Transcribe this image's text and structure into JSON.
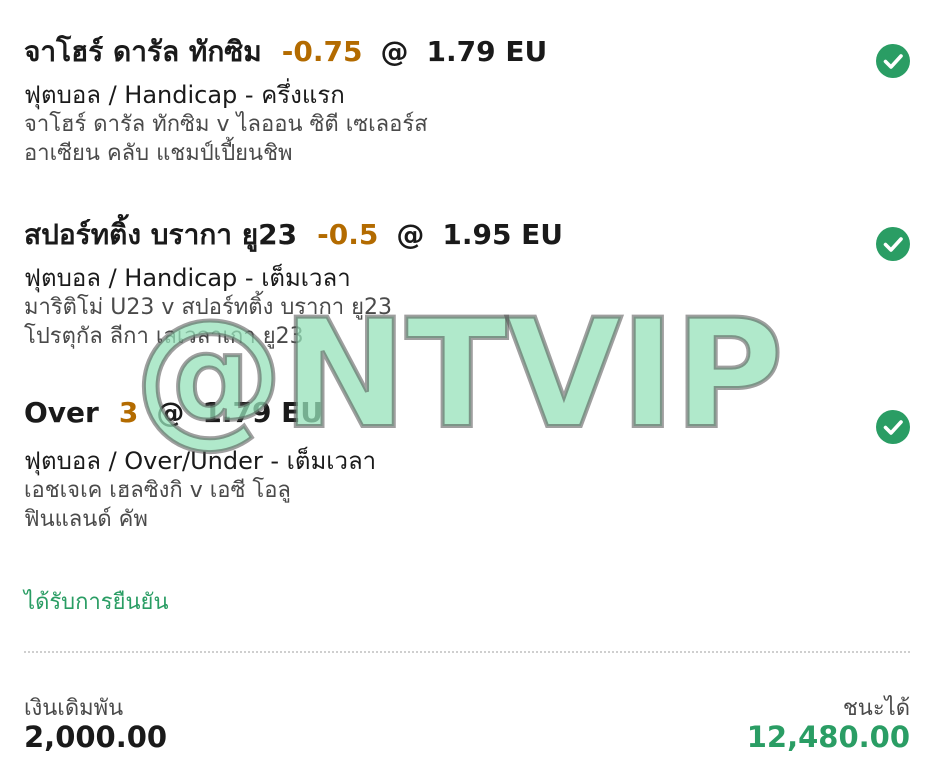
{
  "bets": [
    {
      "selection": "จาโฮร์ ดารัล ทักซิม",
      "handicap": "-0.75",
      "at": "@",
      "odds": "1.79 EU",
      "market": "ฟุตบอล / Handicap - ครึ่งแรก",
      "match": "จาโฮร์ ดารัล ทักซิม v ไลออน ซิตี เซเลอร์ส",
      "league": "อาเซียน คลับ แชมป์เปี้ยนชิพ",
      "status_icon": "check-circle-icon"
    },
    {
      "selection": "สปอร์ทติ้ง บรากา ยู23",
      "handicap": "-0.5",
      "at": "@",
      "odds": "1.95 EU",
      "market": "ฟุตบอล / Handicap - เต็มเวลา",
      "match": "มาริติโม่ U23 v สปอร์ทติ้ง บรากา ยู23",
      "league": "โปรตุกัล ลีกา เลเวลาเกา ยู23",
      "status_icon": "check-circle-icon"
    },
    {
      "selection": "Over",
      "handicap": "3",
      "at": "@",
      "odds": "1.79 EU",
      "market": "ฟุตบอล / Over/Under - เต็มเวลา",
      "match": "เอชเจเค เฮลซิงกิ v เอซี โอลู",
      "league": "ฟินแลนด์ คัพ",
      "status_icon": "check-circle-icon"
    }
  ],
  "status_text": "ได้รับการยืนยัน",
  "stake": {
    "label": "เงินเดิมพัน",
    "value": "2,000.00"
  },
  "winnings": {
    "label": "ชนะได้",
    "value": "12,480.00"
  },
  "watermark": "@NTVIP",
  "colors": {
    "accent_green": "#2a9d64",
    "handicap_orange": "#b36b00",
    "watermark_green": "#96e1b9"
  }
}
